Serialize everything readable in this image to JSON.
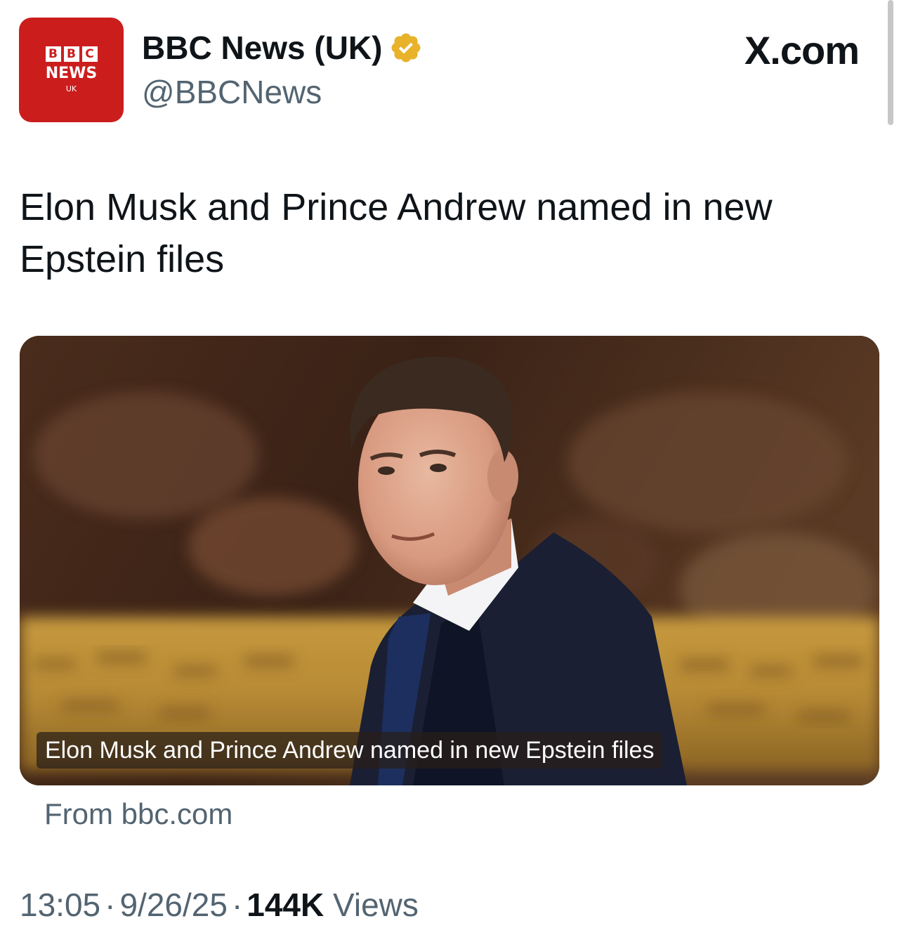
{
  "account": {
    "display_name": "BBC News (UK)",
    "handle": "@BBCNews",
    "avatar": {
      "blocks": [
        "B",
        "B",
        "C"
      ],
      "line1": "NEWS",
      "line2": "UK",
      "color": "#cc1d1d"
    },
    "verified_icon": "verified-badge-gold-icon",
    "verified_color": "#e8b32a"
  },
  "header": {
    "site_logo": "X.com"
  },
  "tweet": {
    "text": "Elon Musk and Prince Andrew named in new Epstein files"
  },
  "media": {
    "caption": "Elon Musk and Prince Andrew named in new Epstein files",
    "source": "From bbc.com"
  },
  "meta": {
    "time": "13:05",
    "date": "9/26/25",
    "views_count": "144K",
    "views_label": "Views",
    "separator": "·"
  },
  "colors": {
    "text_primary": "#0f1419",
    "text_secondary": "#536471"
  }
}
